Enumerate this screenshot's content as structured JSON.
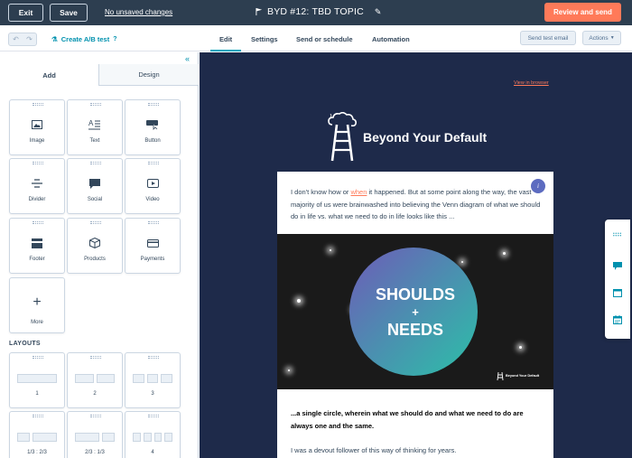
{
  "topbar": {
    "exit_label": "Exit",
    "save_label": "Save",
    "unsaved_label": "No unsaved changes",
    "title": "BYD #12: TBD TOPIC",
    "review_label": "Review and send"
  },
  "toolbar": {
    "ab_test_label": "Create A/B test",
    "tabs": [
      "Edit",
      "Settings",
      "Send or schedule",
      "Automation"
    ],
    "active_tab": "Edit",
    "send_test_label": "Send test email",
    "actions_label": "Actions"
  },
  "panel": {
    "tabs": [
      "Add",
      "Design"
    ],
    "active_tab": "Add",
    "modules": [
      {
        "label": "Image",
        "icon": "image-icon"
      },
      {
        "label": "Text",
        "icon": "text-icon"
      },
      {
        "label": "Button",
        "icon": "button-icon"
      },
      {
        "label": "Divider",
        "icon": "divider-icon"
      },
      {
        "label": "Social",
        "icon": "social-icon"
      },
      {
        "label": "Video",
        "icon": "video-icon"
      },
      {
        "label": "Footer",
        "icon": "footer-icon"
      },
      {
        "label": "Products",
        "icon": "products-icon"
      },
      {
        "label": "Payments",
        "icon": "payments-icon"
      },
      {
        "label": "More",
        "icon": "plus-icon"
      }
    ],
    "layouts_heading": "LAYOUTS",
    "layouts": [
      "1",
      "2",
      "3",
      "1/3 : 2/3",
      "2/3 : 1/3",
      "4"
    ]
  },
  "email": {
    "view_in_browser": "View in browser",
    "brand_name": "Beyond Your Default",
    "para1_before": "I don't know how or ",
    "para1_link": "when",
    "para1_after": " it happened. But at some point along the way, the vast majority of us were brainwashed into believing the Venn diagram of what we should do in life vs. what we need to do in life looks like this ...",
    "info_badge": "i",
    "hero_line1": "SHOULDS",
    "hero_line2": "+",
    "hero_line3": "NEEDS",
    "hero_brand": "Beyond Your Default",
    "para2": "...a single circle, wherein what we should do and what we need to do are always one and the same.",
    "para3": "I was a devout follower of this way of thinking for years."
  },
  "colors": {
    "topbar_bg": "#2d3e50",
    "accent_orange": "#ff7a59",
    "link_teal": "#0091ae",
    "canvas_bg": "#1e2a4a"
  }
}
